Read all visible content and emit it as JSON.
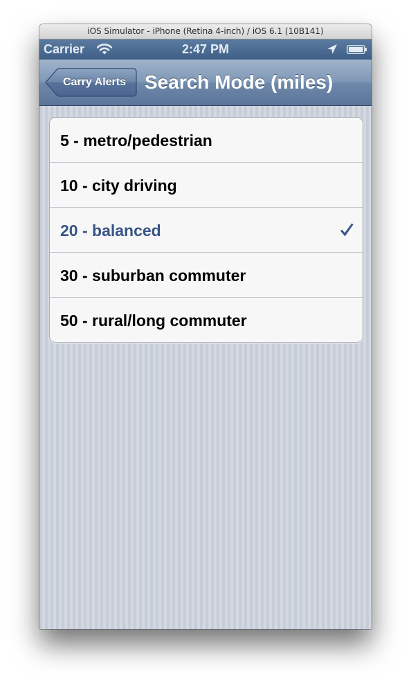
{
  "window": {
    "title": "iOS Simulator - iPhone (Retina 4-inch) / iOS 6.1 (10B141)"
  },
  "status_bar": {
    "carrier": "Carrier",
    "time": "2:47 PM",
    "icons": [
      "wifi-icon",
      "location-icon",
      "battery-icon"
    ]
  },
  "nav_bar": {
    "back_label": "Carry Alerts",
    "title": "Search Mode (miles)"
  },
  "options": [
    {
      "label": "5 - metro/pedestrian",
      "selected": false
    },
    {
      "label": "10 - city driving",
      "selected": false
    },
    {
      "label": "20 - balanced",
      "selected": true
    },
    {
      "label": "30 - suburban commuter",
      "selected": false
    },
    {
      "label": "50 - rural/long commuter",
      "selected": false
    }
  ],
  "colors": {
    "selected_text": "#385487",
    "nav_bar": "#6d88aa",
    "status_bar": "#3f5f86"
  }
}
